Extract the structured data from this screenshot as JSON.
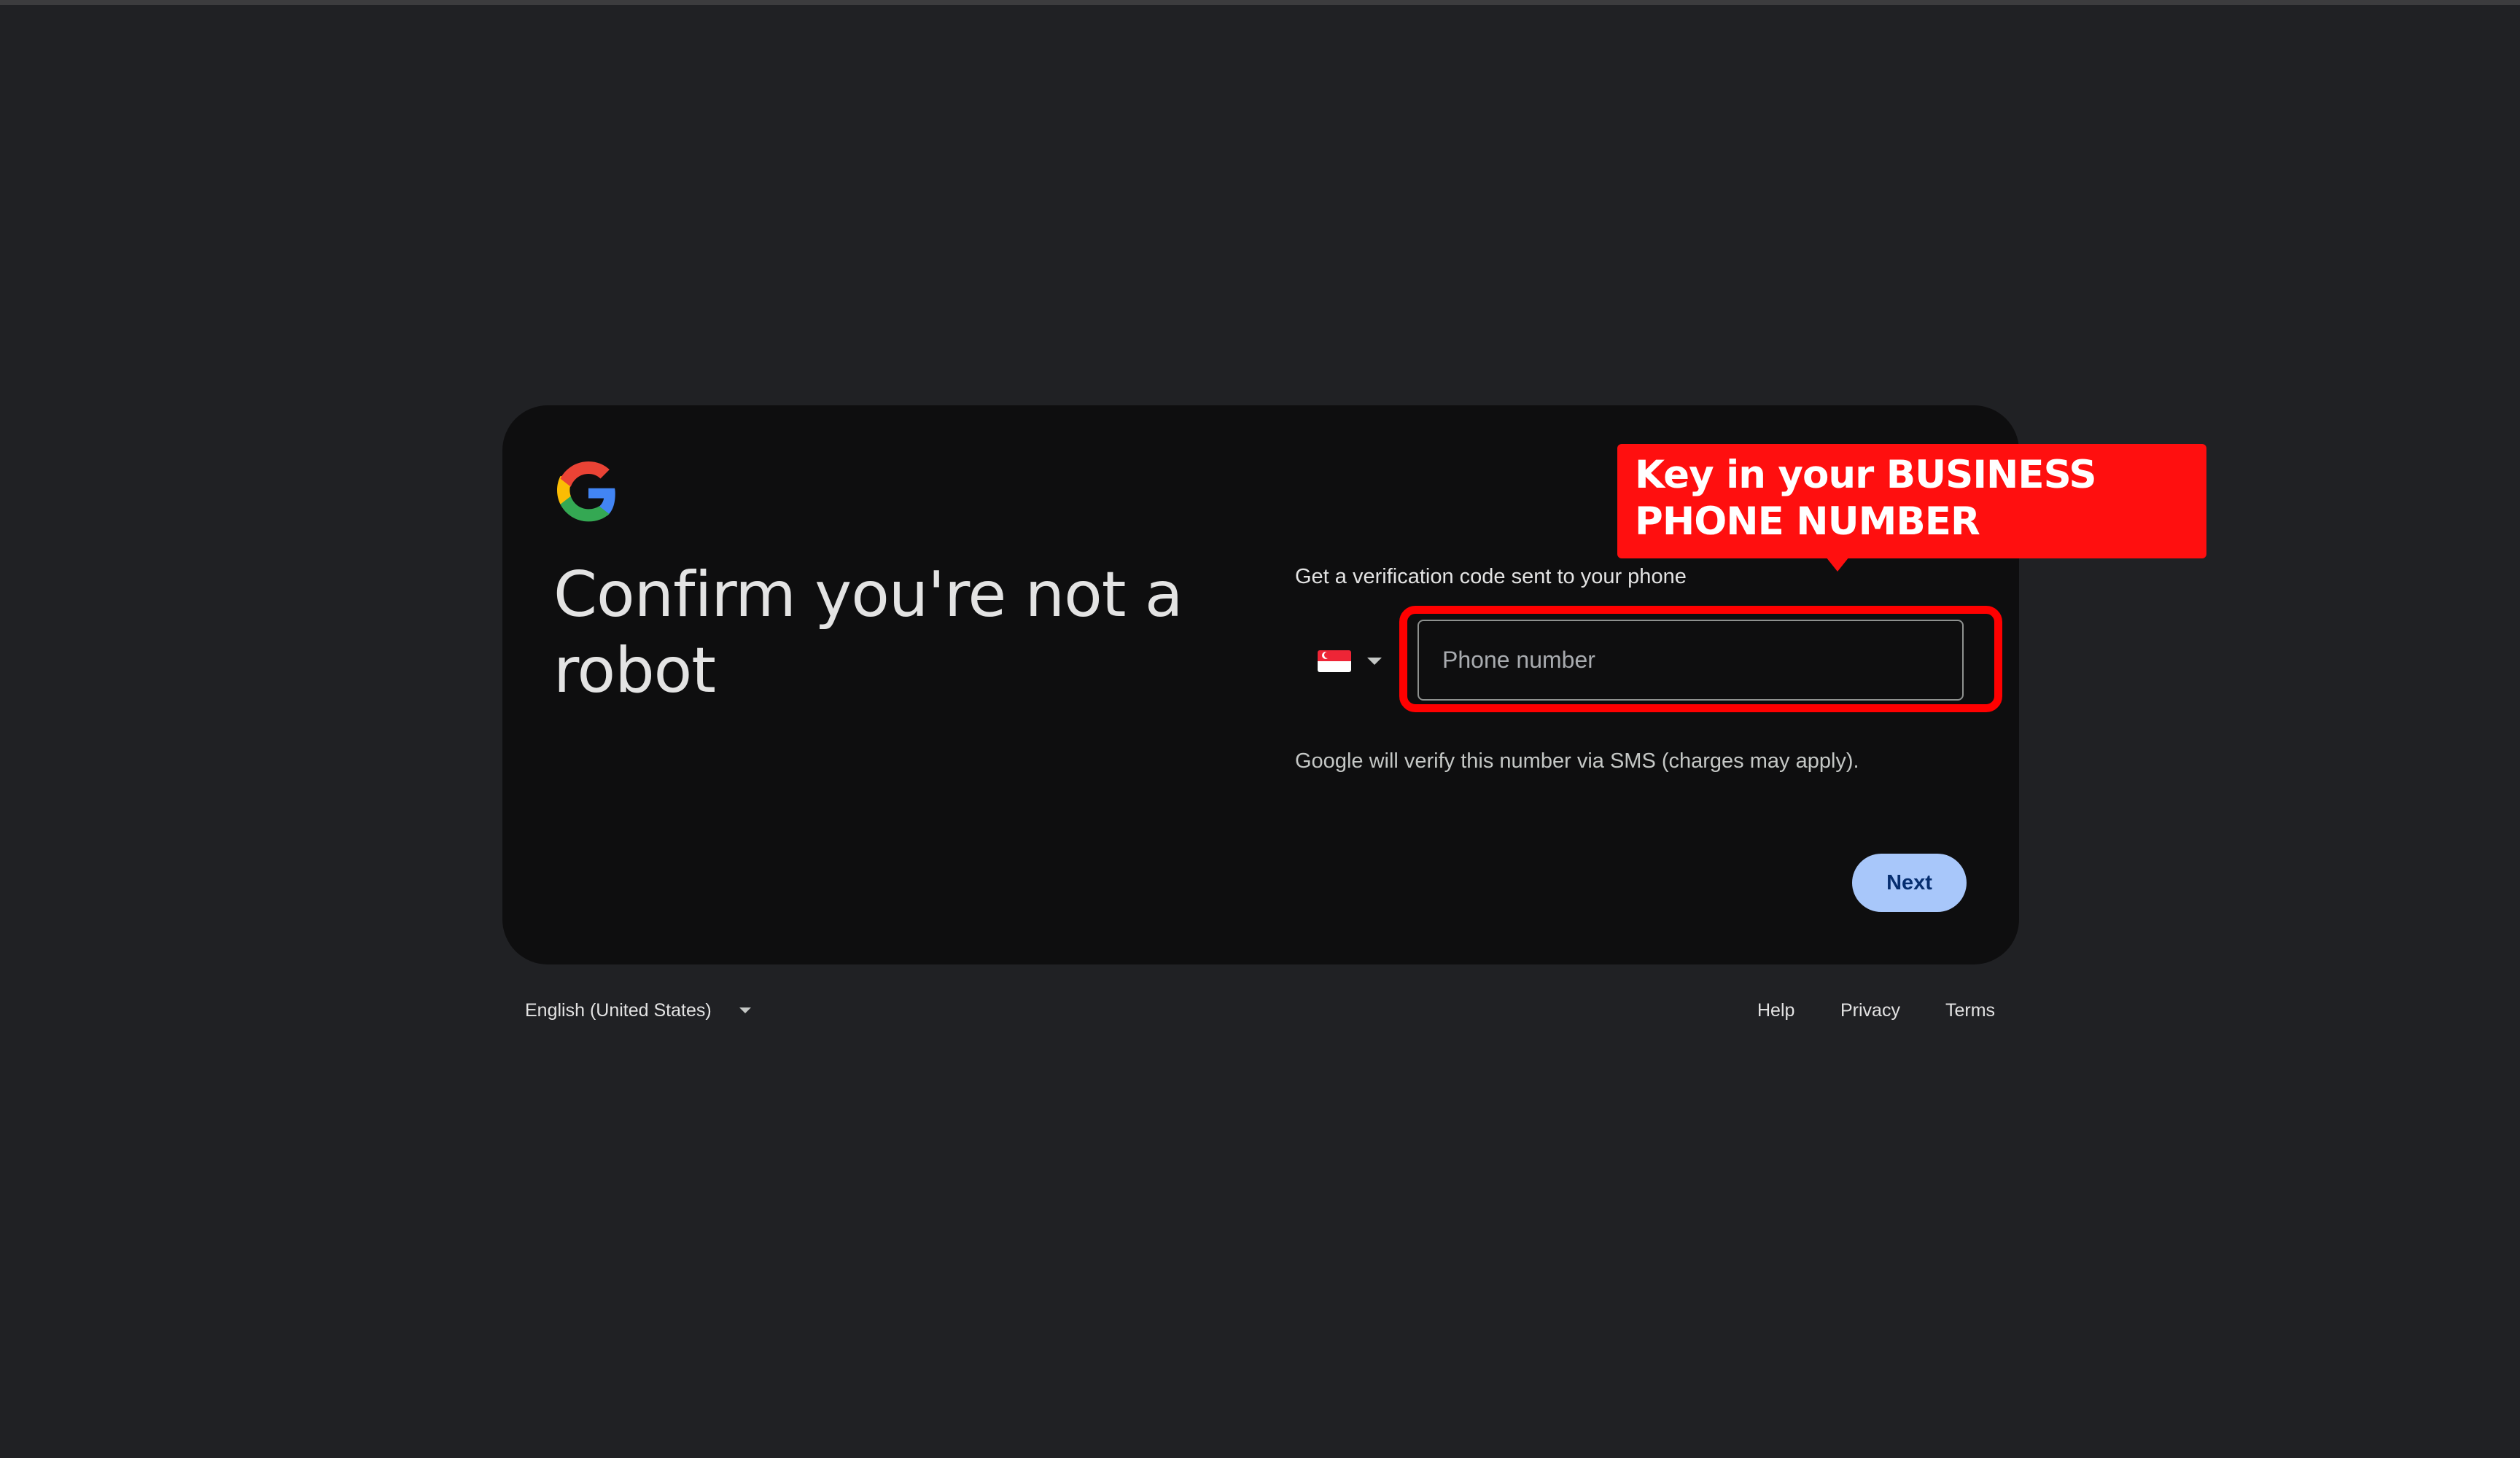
{
  "card": {
    "title": "Confirm you're not a robot",
    "instructions": "Get a verification code sent to your phone",
    "country": {
      "flag_icon": "singapore-flag-icon"
    },
    "phone_input": {
      "value": "",
      "placeholder": "Phone number"
    },
    "sms_note": "Google will verify this number via SMS (charges may apply).",
    "next_label": "Next"
  },
  "annotation": {
    "callout_text": "Key in your BUSINESS PHONE NUMBER",
    "color": "#ff0f0f"
  },
  "footer": {
    "language": "English (United States)",
    "links": {
      "help": "Help",
      "privacy": "Privacy",
      "terms": "Terms"
    }
  },
  "colors": {
    "page_background": "#202124",
    "card_background": "#0e0e0f",
    "button_background": "#a8c7fa",
    "button_text": "#062e6f",
    "google_blue": "#4285f4",
    "google_red": "#ea4335",
    "google_yellow": "#fbbc04",
    "google_green": "#34a853"
  }
}
